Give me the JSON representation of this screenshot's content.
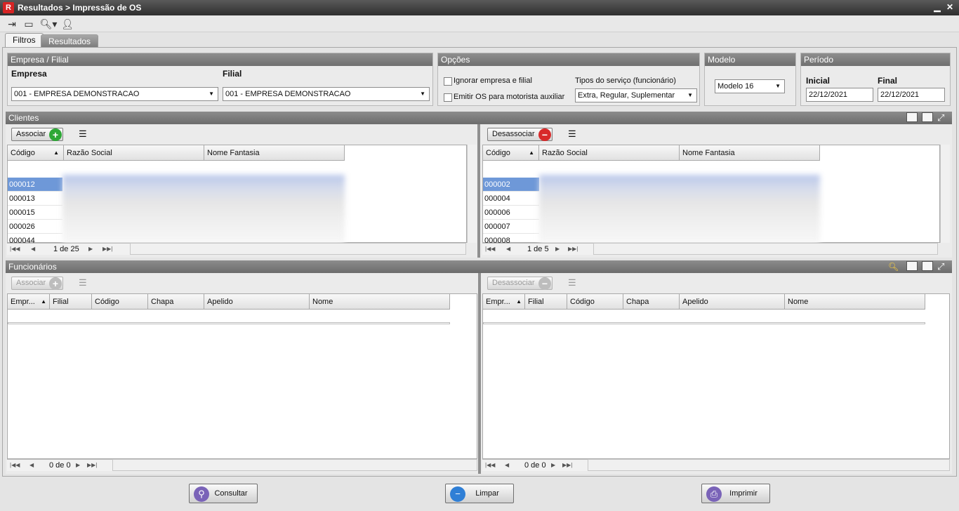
{
  "window": {
    "title": "Resultados > Impressão de OS",
    "logo_text": "R"
  },
  "tabs": [
    {
      "label": "Filtros"
    },
    {
      "label": "Resultados"
    }
  ],
  "empresa_filial": {
    "header": "Empresa / Filial",
    "empresa_label": "Empresa",
    "empresa_value": "001 - EMPRESA DEMONSTRACAO",
    "filial_label": "Filial",
    "filial_value": "001 - EMPRESA DEMONSTRACAO"
  },
  "opcoes": {
    "header": "Opções",
    "ignorar_label": "Ignorar empresa e filial",
    "emitir_label": "Emitir OS para motorista auxiliar",
    "tipos_label": "Tipos do serviço (funcionário)",
    "tipos_value": "Extra, Regular, Suplementar"
  },
  "modelo": {
    "header": "Modelo",
    "value": "Modelo 16"
  },
  "periodo": {
    "header": "Período",
    "inicial_label": "Inicial",
    "final_label": "Final",
    "inicial_value": "22/12/2021",
    "final_value": "22/12/2021"
  },
  "clientes": {
    "header": "Clientes",
    "associar": "Associar",
    "desassociar": "Desassociar",
    "columns": [
      "Código",
      "Razão Social",
      "Nome Fantasia"
    ],
    "left_rows": [
      "000012",
      "000013",
      "000015",
      "000026",
      "000044"
    ],
    "right_rows": [
      "000002",
      "000004",
      "000006",
      "000007",
      "000008"
    ],
    "left_pager": "1 de 25",
    "right_pager": "1 de 5"
  },
  "funcionarios": {
    "header": "Funcionários",
    "associar": "Associar",
    "desassociar": "Desassociar",
    "columns": [
      "Empr...",
      "Filial",
      "Código",
      "Chapa",
      "Apelido",
      "Nome"
    ],
    "left_pager": "0 de 0",
    "right_pager": "0 de 0"
  },
  "actions": {
    "consultar": "Consultar",
    "limpar": "Limpar",
    "imprimir": "Imprimir"
  }
}
